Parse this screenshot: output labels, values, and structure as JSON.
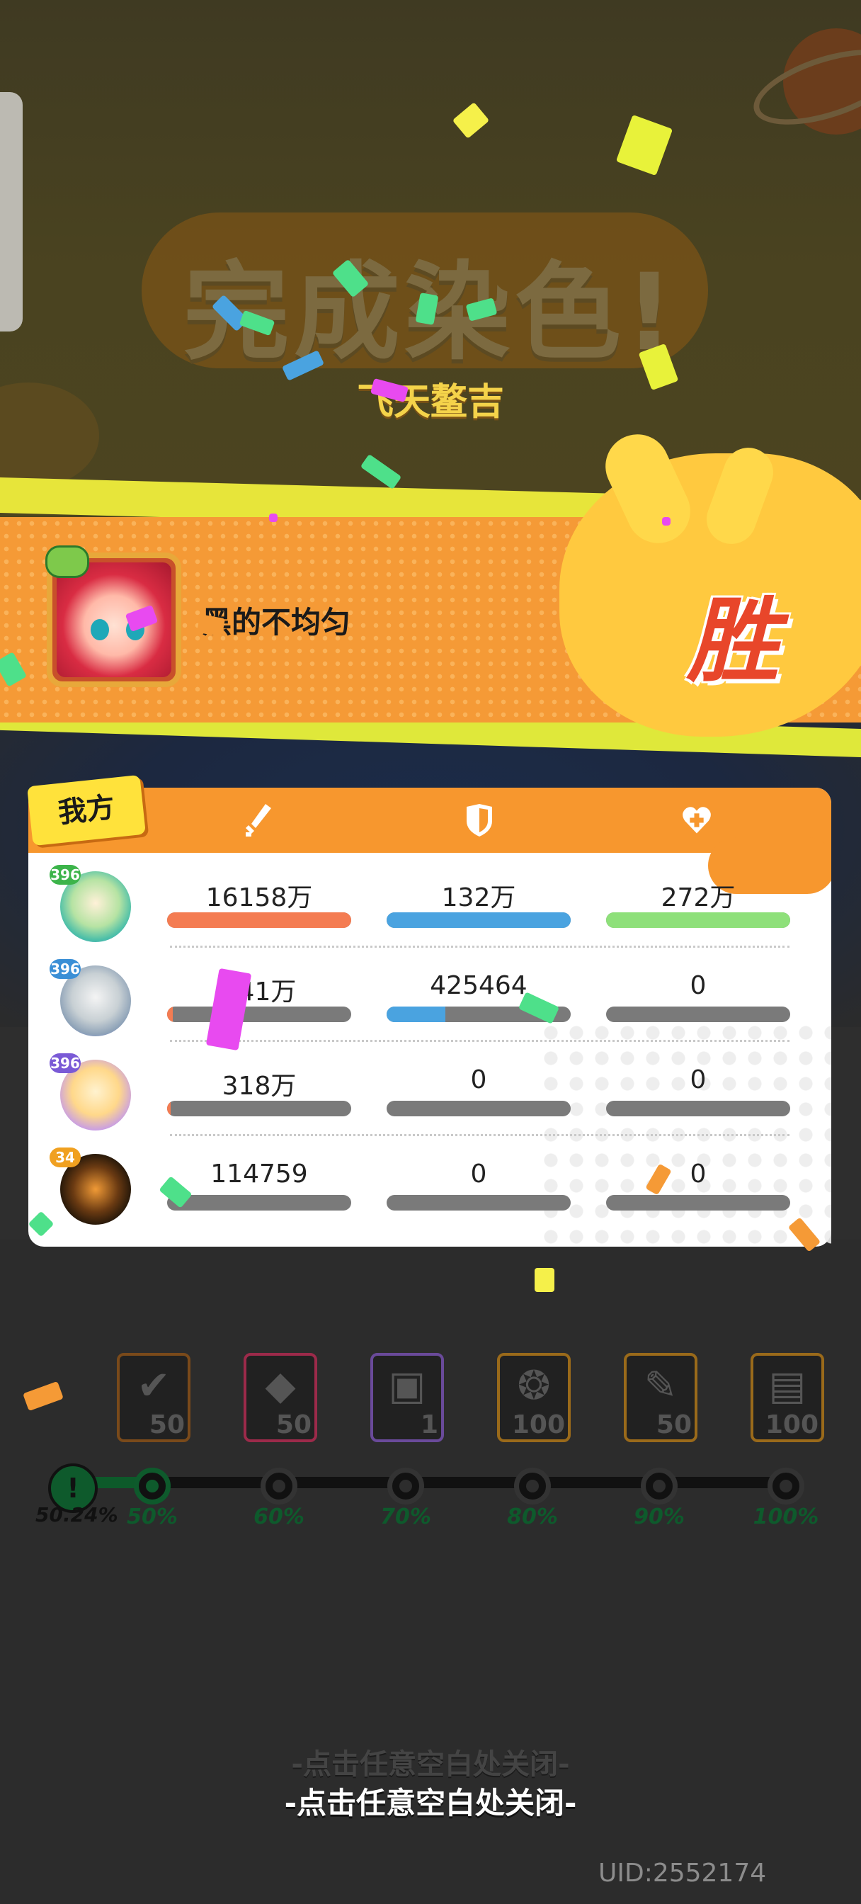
{
  "result": {
    "title": "完成染色!",
    "subtitle": "飞天鳌吉",
    "player_name": "黑的不均匀",
    "outcome": "胜"
  },
  "panel": {
    "team_label": "我方",
    "header_icons": [
      "sword-icon",
      "shield-icon",
      "heart-plus-icon"
    ],
    "rows": [
      {
        "level": "396",
        "damage": "16158万",
        "tank": "132万",
        "heal": "272万",
        "damage_fill": 1.0,
        "tank_fill": 1.0,
        "heal_fill": 1.0
      },
      {
        "level": "396",
        "damage": "541万",
        "tank": "425464",
        "heal": "0",
        "damage_fill": 0.03,
        "tank_fill": 0.32,
        "heal_fill": 0.0
      },
      {
        "level": "396",
        "damage": "318万",
        "tank": "0",
        "heal": "0",
        "damage_fill": 0.02,
        "tank_fill": 0.0,
        "heal_fill": 0.0
      },
      {
        "level": "34",
        "damage": "114759",
        "tank": "0",
        "heal": "0",
        "damage_fill": 0.0,
        "tank_fill": 0.0,
        "heal_fill": 0.0
      }
    ],
    "colors": {
      "damage": "#f47c52",
      "tank": "#4aa3e0",
      "heal": "#8ee07a",
      "empty": "#7a7a7a"
    }
  },
  "rewards": [
    {
      "icon": "brush-check-icon",
      "count": "50",
      "border": "#7a4a1a"
    },
    {
      "icon": "diamond-icon",
      "count": "50",
      "border": "#9c2a4a"
    },
    {
      "icon": "gift-box-icon",
      "count": "1",
      "border": "#6a4a9a"
    },
    {
      "icon": "gold-medal-icon",
      "count": "100",
      "border": "#9a6a1a"
    },
    {
      "icon": "pencil-icon",
      "count": "50",
      "border": "#9a6a1a"
    },
    {
      "icon": "ticket-icon",
      "count": "100",
      "border": "#9a6a1a"
    }
  ],
  "progress": {
    "current": "50.24%",
    "current_value": 50.24,
    "milestones": [
      "50%",
      "60%",
      "70%",
      "80%",
      "90%",
      "100%"
    ]
  },
  "close_hint": "-点击任意空白处关闭-",
  "uid": "UID:2552174"
}
